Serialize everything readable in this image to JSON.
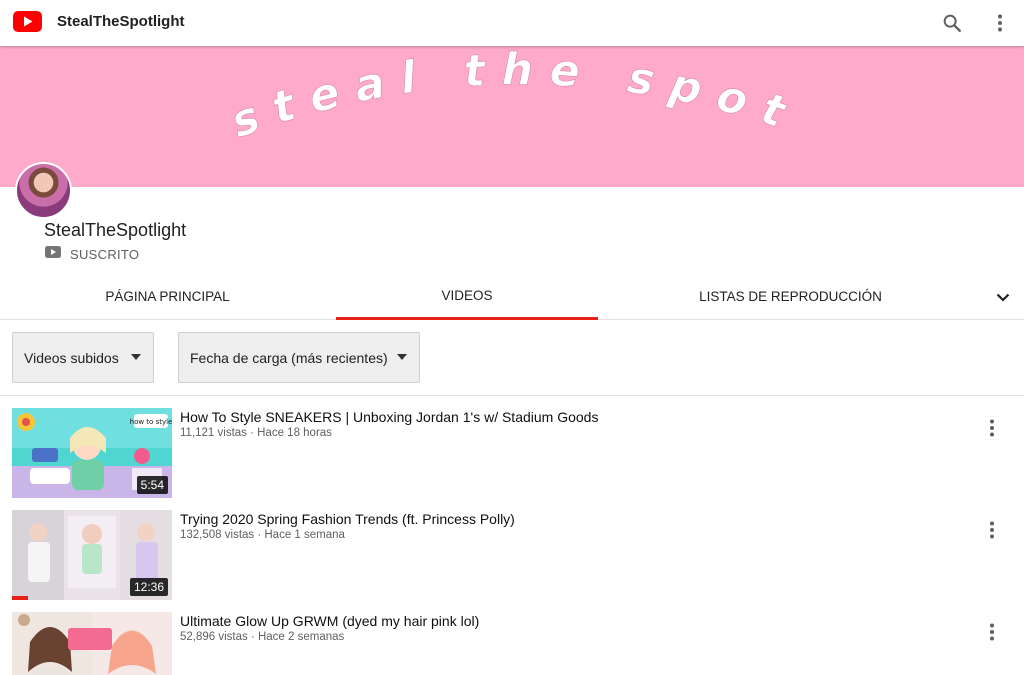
{
  "app": {
    "title": "StealTheSpotlight",
    "colors": {
      "brand_red": "#ff0000",
      "banner_pink": "#ffaacb",
      "accent_underline": "#e62117"
    },
    "icons": {
      "logo": "youtube-logo-icon",
      "search": "search-icon",
      "more": "more-vertical-icon"
    }
  },
  "banner": {
    "text": "steal the spotlight"
  },
  "channel": {
    "name": "StealTheSpotlight",
    "subscribed_label": "SUSCRITO",
    "subscribed_icon": "youtube-small-icon"
  },
  "tabs": {
    "home": "PÁGINA PRINCIPAL",
    "videos": "VIDEOS",
    "playlists": "LISTAS DE REPRODUCCIÓN",
    "selected": "videos",
    "expand_icon": "chevron-down-icon"
  },
  "filters": {
    "type": {
      "selected": "Videos subidos"
    },
    "sort": {
      "selected": "Fecha de carga (más recientes)"
    }
  },
  "videos": [
    {
      "title": "How To Style SNEAKERS | Unboxing Jordan 1's w/ Stadium Goods",
      "meta": "11,121 vistas · Hace 18 horas",
      "duration": "5:54"
    },
    {
      "title": "Trying 2020 Spring Fashion Trends (ft. Princess Polly)",
      "meta": "132,508 vistas · Hace 1 semana",
      "duration": "12:36",
      "watched_fraction": 0.1
    },
    {
      "title": "Ultimate Glow Up GRWM (dyed my hair pink lol)",
      "meta": "52,896 vistas · Hace 2 semanas",
      "duration": ""
    }
  ]
}
